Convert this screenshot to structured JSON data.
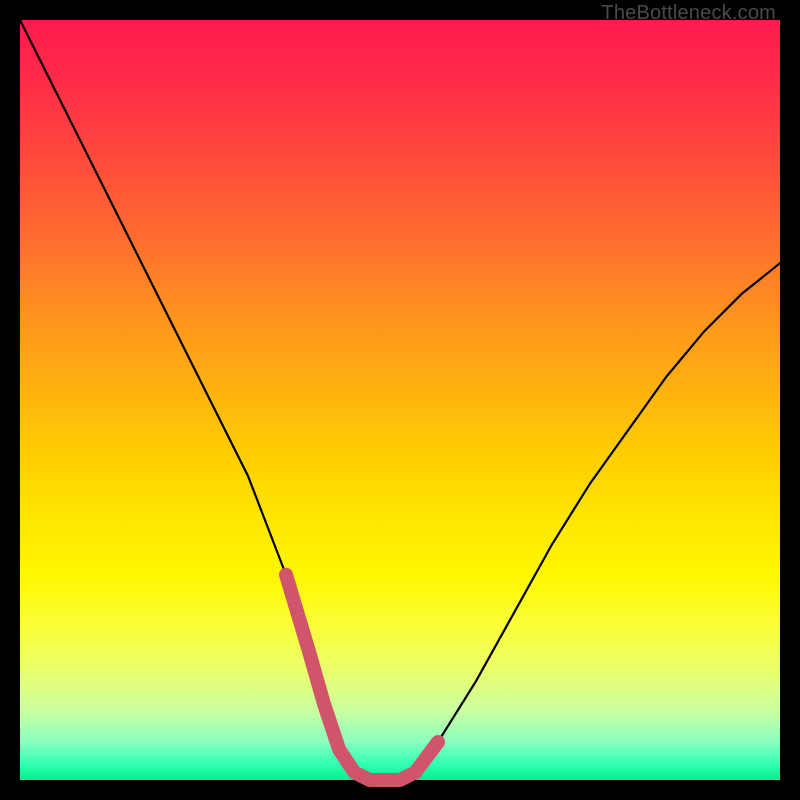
{
  "watermark": "TheBottleneck.com",
  "chart_data": {
    "type": "line",
    "title": "",
    "xlabel": "",
    "ylabel": "",
    "xlim": [
      0,
      100
    ],
    "ylim": [
      0,
      100
    ],
    "series": [
      {
        "name": "bottleneck-curve",
        "x": [
          0,
          5,
          10,
          15,
          20,
          25,
          30,
          35,
          38,
          40,
          42,
          44,
          46,
          48,
          50,
          52,
          55,
          60,
          65,
          70,
          75,
          80,
          85,
          90,
          95,
          100
        ],
        "y": [
          100,
          90,
          80,
          70,
          60,
          50,
          40,
          27,
          17,
          10,
          4,
          1,
          0,
          0,
          0,
          1,
          5,
          13,
          22,
          31,
          39,
          46,
          53,
          59,
          64,
          68
        ]
      }
    ],
    "highlight": {
      "name": "valley-segment",
      "color": "#d0546a",
      "x": [
        35,
        38,
        40,
        42,
        44,
        46,
        48,
        50,
        52,
        55
      ],
      "y": [
        27,
        17,
        10,
        4,
        1,
        0,
        0,
        0,
        1,
        5
      ]
    },
    "gradient_stops": [
      {
        "pos": 0,
        "color": "#ff1a4d"
      },
      {
        "pos": 50,
        "color": "#ffd000"
      },
      {
        "pos": 80,
        "color": "#faff3a"
      },
      {
        "pos": 100,
        "color": "#00f090"
      }
    ]
  }
}
